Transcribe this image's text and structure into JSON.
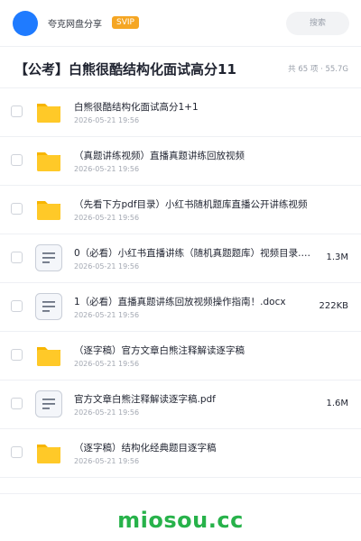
{
  "topbar": {
    "site_name": "夸克网盘分享",
    "badge": "SVIP",
    "search_label": "搜索",
    "brand_color": "#1f7bff",
    "badge_color": "#f5a623"
  },
  "header": {
    "title": "【公考】白熊很酷结构化面试高分11",
    "meta": "共 65 项 · 55.7G"
  },
  "files": [
    {
      "type": "folder",
      "icon": "folder-icon",
      "name": "白熊很酷结构化面试高分1+1",
      "date": "2026-05-21 19:56",
      "size": ""
    },
    {
      "type": "folder",
      "icon": "folder-icon",
      "name": "（真题讲练视频）直播真题讲练回放视频",
      "date": "2026-05-21 19:56",
      "size": ""
    },
    {
      "type": "folder",
      "icon": "folder-icon",
      "name": "（先看下方pdf目录）小红书随机题库直播公开讲练视频",
      "date": "2026-05-21 19:56",
      "size": ""
    },
    {
      "type": "doc",
      "icon": "document-icon",
      "name": "0（必看）小红书直播讲练（随机真题题库）视频目录.…",
      "date": "2026-05-21 19:56",
      "size": "1.3M"
    },
    {
      "type": "doc",
      "icon": "document-icon",
      "name": "1（必看）直播真题讲练回放视频操作指南！.docx",
      "date": "2026-05-21 19:56",
      "size": "222KB"
    },
    {
      "type": "folder",
      "icon": "folder-icon",
      "name": "（逐字稿）官方文章白熊注释解读逐字稿",
      "date": "2026-05-21 19:56",
      "size": ""
    },
    {
      "type": "doc",
      "icon": "document-icon",
      "name": "官方文章白熊注释解读逐字稿.pdf",
      "date": "2026-05-21 19:56",
      "size": "1.6M"
    },
    {
      "type": "folder",
      "icon": "folder-icon",
      "name": "（逐字稿）结构化经典题目逐字稿",
      "date": "2026-05-21 19:56",
      "size": ""
    }
  ],
  "watermark": "miosou.cc"
}
